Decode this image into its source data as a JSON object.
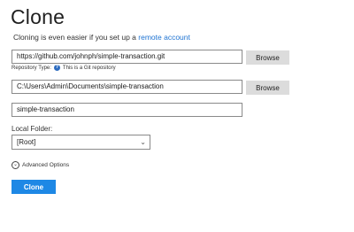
{
  "page": {
    "title": "Clone",
    "subtitle_prefix": "Cloning is even easier if you set up a ",
    "subtitle_link": "remote account"
  },
  "repo_url": {
    "value": "https://github.com/johnph/simple-transaction.git",
    "browse_label": "Browse"
  },
  "repo_type": {
    "label": "Repository Type:",
    "icon": "help-icon",
    "value": "This is a Git repository"
  },
  "destination": {
    "value": "C:\\Users\\Admin\\Documents\\simple-transaction",
    "browse_label": "Browse"
  },
  "name": {
    "value": "simple-transaction"
  },
  "local_folder": {
    "label": "Local Folder:",
    "selected": "[Root]",
    "icon": "chevron-down-icon"
  },
  "advanced": {
    "label": "Advanced Options",
    "icon": "chevron-circle-icon"
  },
  "clone_button": {
    "label": "Clone"
  },
  "colors": {
    "accent": "#1e88e5",
    "link": "#1e73d2",
    "button_bg": "#dcdcdc"
  }
}
